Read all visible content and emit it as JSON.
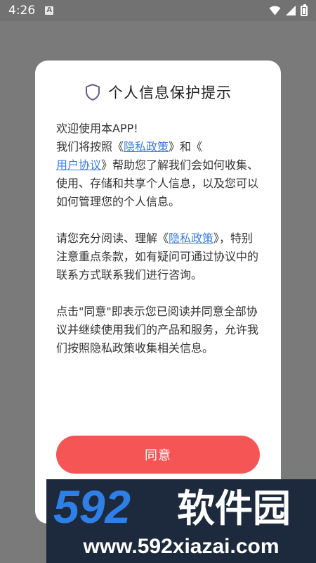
{
  "status_bar": {
    "time": "4:26",
    "notification_icon": "a-icon"
  },
  "dialog": {
    "title": "个人信息保护提示",
    "icon": "shield-icon",
    "greeting": "欢迎使用本APP!",
    "p1_a": "我们将按照《",
    "privacy_policy": "隐私政策",
    "p1_b": "》和《",
    "user_agreement": "用户协议",
    "p1_c": "》帮助您了解我们会如何收集、使用、存储和共享个人信息，以及您可以如何管理您的个人信息。",
    "p2_a": "请您充分阅读、理解《",
    "p2_b": "》，特别注意重点条款，如有疑问可通过协议中的联系方式联系我们进行咨询。",
    "p3": "点击\"同意\"即表示您已阅读并同意全部协议并继续使用我们的产品和服务，允许我们按照隐私政策收集相关信息。",
    "agree_label": "同意"
  },
  "watermark": {
    "logo_text": "592软件园",
    "url": "www.592xiazai.com",
    "colors": {
      "digits": "#2f7fe8",
      "text": "#ffffff",
      "background": "#1d2a3d"
    }
  },
  "colors": {
    "accent": "#f55555",
    "link": "#3d7ee1",
    "overlay": "#7a7a7a"
  }
}
